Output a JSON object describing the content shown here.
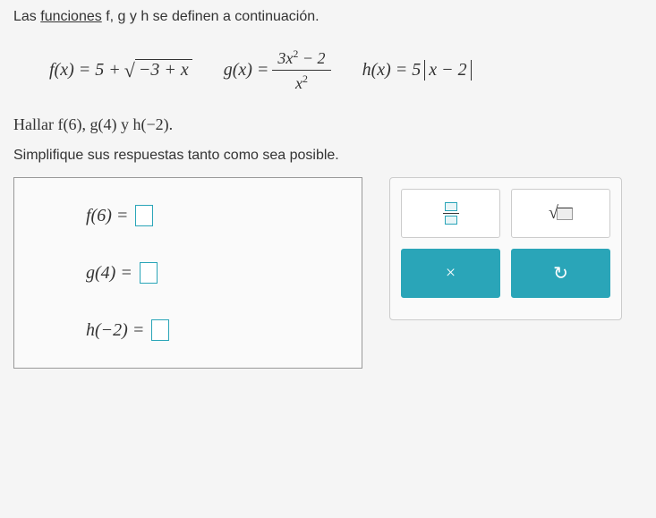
{
  "intro": {
    "prefix": "Las ",
    "link": "funciones",
    "suffix": " f, g y h se definen a continuación."
  },
  "eq": {
    "f_lhs": "f(x) = 5 + ",
    "f_sqrt_arg": "−3 + x",
    "g_lhs": "g(x) = ",
    "g_num_a": "3x",
    "g_num_exp": "2",
    "g_num_b": " − 2",
    "g_den_a": "x",
    "g_den_exp": "2",
    "h_lhs": "h(x) = 5 ",
    "h_abs": "x − 2"
  },
  "task": "Hallar f(6), g(4) y h(−2).",
  "simplify": "Simplifique sus respuestas tanto como sea posible.",
  "answers": {
    "f": "f(6) = ",
    "g": "g(4) = ",
    "h": "h(−2) = "
  },
  "tools": {
    "times": "×",
    "undo": "↻",
    "sqrt": "√"
  }
}
